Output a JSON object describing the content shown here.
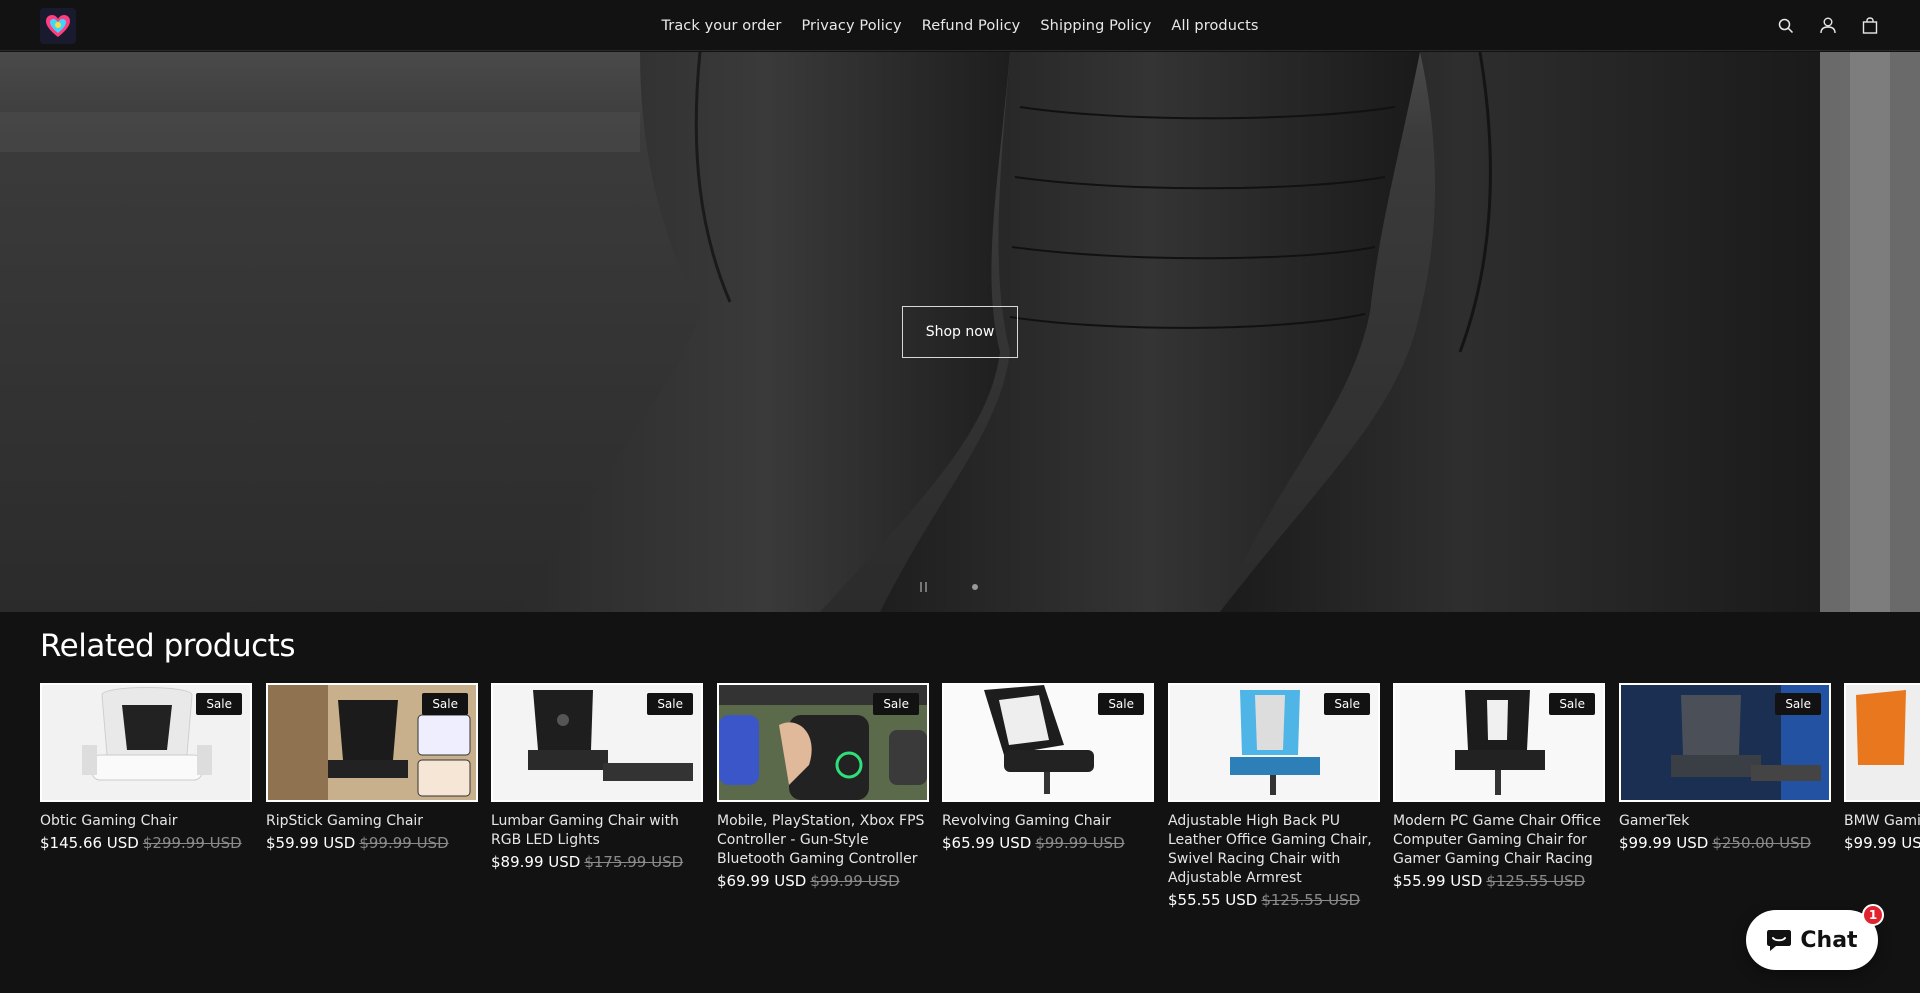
{
  "header": {
    "logo_alt": "store logo",
    "nav": [
      {
        "label": "Track your order"
      },
      {
        "label": "Privacy Policy"
      },
      {
        "label": "Refund Policy"
      },
      {
        "label": "Shipping Policy"
      },
      {
        "label": "All products"
      }
    ],
    "icons": [
      "search-icon",
      "account-icon",
      "cart-icon"
    ]
  },
  "hero": {
    "button_label": "Shop now",
    "slides": 2
  },
  "related": {
    "title": "Related products",
    "products": [
      {
        "title": "Obtic Gaming Chair",
        "price": "$145.66 USD",
        "was": "$299.99 USD",
        "badge": "Sale"
      },
      {
        "title": "RipStick Gaming Chair",
        "price": "$59.99 USD",
        "was": "$99.99 USD",
        "badge": "Sale"
      },
      {
        "title": "Lumbar Gaming Chair with RGB LED Lights",
        "price": "$89.99 USD",
        "was": "$175.99 USD",
        "badge": "Sale"
      },
      {
        "title": "Mobile, PlayStation, Xbox FPS Controller - Gun-Style Bluetooth Gaming Controller",
        "price": "$69.99 USD",
        "was": "$99.99 USD",
        "badge": "Sale"
      },
      {
        "title": "Revolving Gaming Chair",
        "price": "$65.99 USD",
        "was": "$99.99 USD",
        "badge": "Sale"
      },
      {
        "title": "Adjustable High Back PU Leather Office Gaming Chair, Swivel Racing Chair with Adjustable Armrest",
        "price": "$55.55 USD",
        "was": "$125.55 USD",
        "badge": "Sale"
      },
      {
        "title": "Modern PC Game Chair Office Computer Gaming Chair for Gamer Gaming Chair Racing",
        "price": "$55.99 USD",
        "was": "$125.55 USD",
        "badge": "Sale"
      },
      {
        "title": "GamerTek",
        "price": "$99.99 USD",
        "was": "$250.00 USD",
        "badge": "Sale"
      },
      {
        "title": "BMW Gaming",
        "price": "$99.99 US",
        "was": "",
        "badge": ""
      }
    ]
  },
  "chat": {
    "label": "Chat",
    "badge": "1"
  },
  "colors": {
    "background": "#121212",
    "sale_badge": "#121212",
    "chat_badge": "#e0232e"
  }
}
